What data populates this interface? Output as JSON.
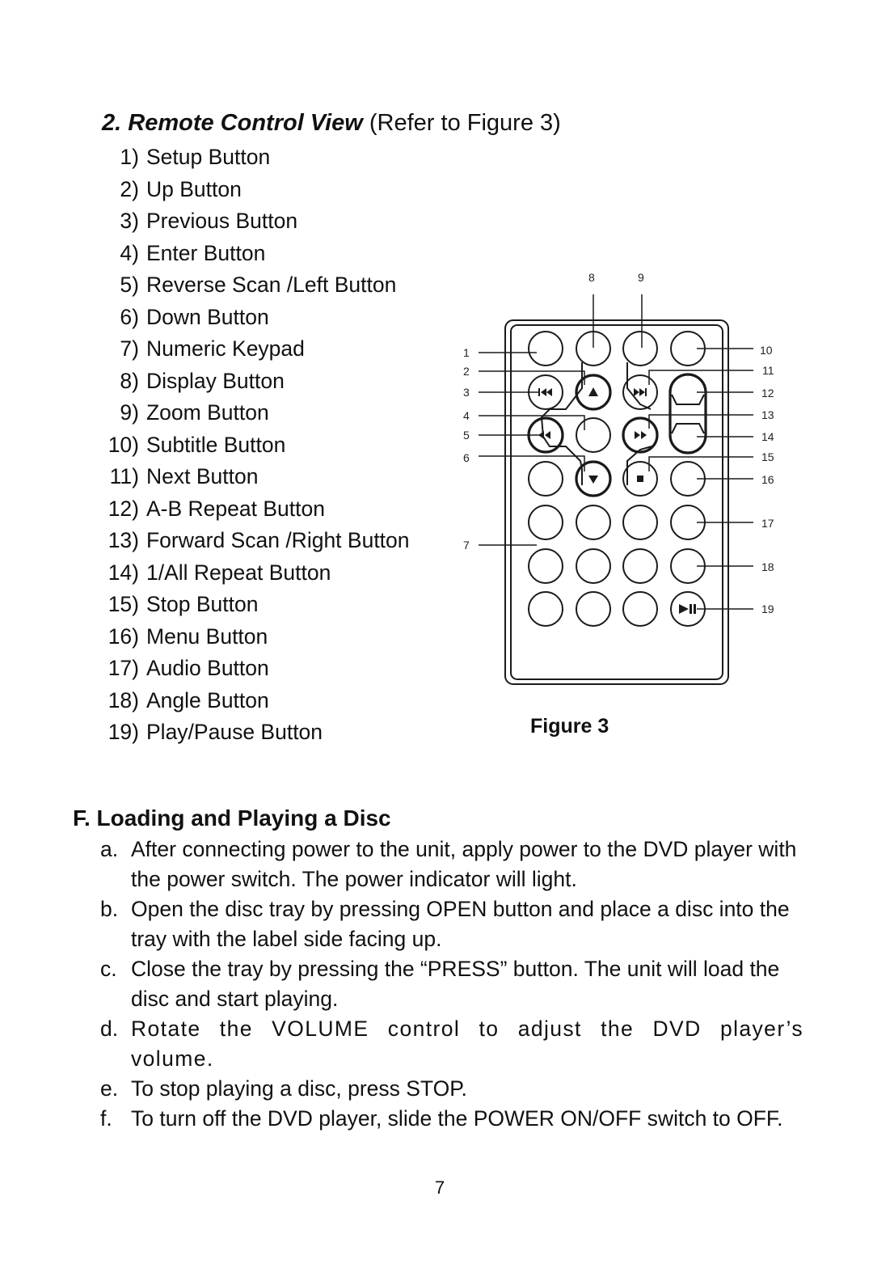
{
  "section2": {
    "number": "2.",
    "title": "Remote Control View",
    "ref": " (Refer to Figure 3)"
  },
  "buttons": [
    {
      "num": "1)",
      "label": "Setup Button"
    },
    {
      "num": "2)",
      "label": "Up Button"
    },
    {
      "num": "3)",
      "label": "Previous Button"
    },
    {
      "num": "4)",
      "label": "Enter Button"
    },
    {
      "num": "5)",
      "label": "Reverse Scan /Left Button"
    },
    {
      "num": "6)",
      "label": "Down Button"
    },
    {
      "num": "7)",
      "label": "Numeric Keypad"
    },
    {
      "num": "8)",
      "label": "Display Button"
    },
    {
      "num": "9)",
      "label": "Zoom Button"
    },
    {
      "num": "10)",
      "label": "Subtitle Button"
    },
    {
      "num": "11)",
      "label": "Next Button"
    },
    {
      "num": "12)",
      "label": "A-B Repeat Button"
    },
    {
      "num": "13)",
      "label": "Forward Scan /Right Button"
    },
    {
      "num": "14)",
      "label": "1/All Repeat Button"
    },
    {
      "num": "15)",
      "label": "Stop Button"
    },
    {
      "num": "16)",
      "label": "Menu Button"
    },
    {
      "num": "17)",
      "label": "Audio Button"
    },
    {
      "num": "18)",
      "label": "Angle Button"
    },
    {
      "num": "19)",
      "label": "Play/Pause Button"
    }
  ],
  "figure": {
    "caption": "Figure 3",
    "callouts": {
      "c1": "1",
      "c2": "2",
      "c3": "3",
      "c4": "4",
      "c5": "5",
      "c6": "6",
      "c7": "7",
      "c8": "8",
      "c9": "9",
      "c10": "10",
      "c11": "11",
      "c12": "12",
      "c13": "13",
      "c14": "14",
      "c15": "15",
      "c16": "16",
      "c17": "17",
      "c18": "18",
      "c19": "19"
    },
    "icons": [
      "previous-icon",
      "up-arrow-icon",
      "next-icon",
      "reverse-scan-icon",
      "forward-scan-icon",
      "down-arrow-icon",
      "stop-icon",
      "play-pause-icon"
    ]
  },
  "sectionF": {
    "title": "F. Loading and Playing a Disc",
    "steps": [
      {
        "letter": "a.",
        "text": "After connecting power to the unit, apply power to the DVD player with the power switch. The power indicator will light."
      },
      {
        "letter": "b.",
        "text": "Open the disc tray by pressing OPEN button and place a disc into the tray with the label side facing up."
      },
      {
        "letter": "c.",
        "text": "Close the tray by pressing the “PRESS” button. The unit will load the disc and start playing."
      },
      {
        "letter": "d.",
        "text": "Rotate the VOLUME control to adjust the DVD player’s volume."
      },
      {
        "letter": "e.",
        "text": "To stop playing a disc, press STOP."
      },
      {
        "letter": "f.",
        "text": "To turn off the DVD player, slide the POWER ON/OFF switch to OFF."
      }
    ]
  },
  "page_number": "7"
}
